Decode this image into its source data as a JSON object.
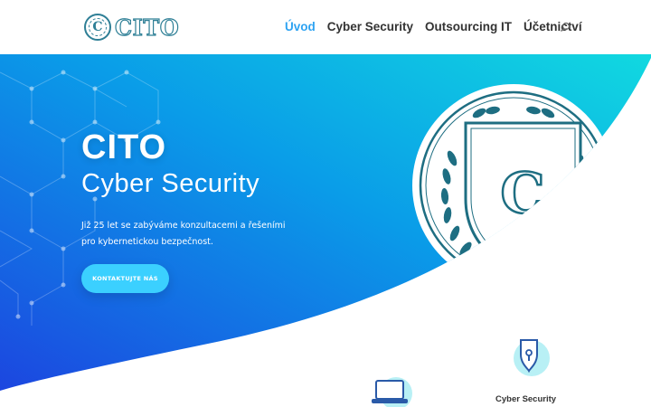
{
  "header": {
    "logo_text": "CITO",
    "logo_mark_letter": "C",
    "nav": [
      "Úvod",
      "Cyber Security",
      "Outsourcing IT",
      "Účetnictví"
    ],
    "active_nav": "Úvod",
    "search_icon": "search-icon"
  },
  "hero": {
    "title": "CITO",
    "subtitle": "Cyber Security",
    "text": "Již 25 let se zabýváme konzultacemi a řešeními pro kybernetickou bezpečnost.",
    "cta_label": "KONTAKTUJTE NÁS",
    "emblem_letter": "C",
    "gradient": [
      "#1c46e0",
      "#0a9ce8",
      "#11d9e0"
    ]
  },
  "services": {
    "items": [
      {
        "icon": "laptop-icon",
        "label": ""
      },
      {
        "icon": "shield-lock-icon",
        "label": "Cyber Security"
      }
    ]
  },
  "colors": {
    "brand": "#2e7f96",
    "nav_active": "#2ea3f2",
    "cta": "#3bd0ff"
  }
}
